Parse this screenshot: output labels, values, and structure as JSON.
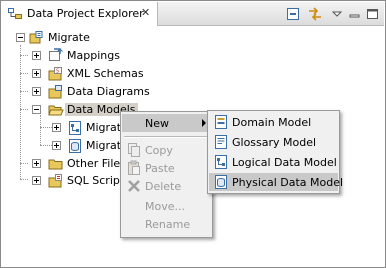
{
  "view": {
    "title": "Data Project Explorer",
    "close_glyph": "✕"
  },
  "toolbar": {
    "icons": [
      "collapse-all-icon",
      "link-with-editor-icon",
      "view-menu-icon",
      "minimize-icon",
      "maximize-icon"
    ]
  },
  "tree": {
    "root": {
      "label": "Migrate",
      "icon": "data-project-icon",
      "expanded": true
    },
    "items": [
      {
        "label": "Mappings",
        "icon": "mappings-icon"
      },
      {
        "label": "XML Schemas",
        "icon": "xml-schemas-icon"
      },
      {
        "label": "Data Diagrams",
        "icon": "data-diagrams-icon"
      },
      {
        "label": "Data Models",
        "icon": "folder-open-icon",
        "expanded": true,
        "selected": true,
        "children": [
          {
            "label": "Migrate",
            "icon": "logical-model-icon"
          },
          {
            "label": "Migrate",
            "icon": "physical-model-icon"
          }
        ]
      },
      {
        "label": "Other Files",
        "icon": "folder-icon"
      },
      {
        "label": "SQL Scripts",
        "icon": "sql-scripts-icon"
      }
    ]
  },
  "context_menu": {
    "items": [
      {
        "label": "New",
        "enabled": true,
        "submenu": true,
        "highlighted": true
      },
      {
        "label": "Copy",
        "enabled": false,
        "icon": "copy-icon"
      },
      {
        "label": "Paste",
        "enabled": false,
        "icon": "paste-icon"
      },
      {
        "label": "Delete",
        "enabled": false,
        "icon": "delete-icon"
      },
      {
        "label": "Move...",
        "enabled": false
      },
      {
        "label": "Rename",
        "enabled": false
      }
    ]
  },
  "submenu": {
    "items": [
      {
        "label": "Domain Model",
        "icon": "domain-model-icon"
      },
      {
        "label": "Glossary Model",
        "icon": "glossary-model-icon"
      },
      {
        "label": "Logical Data Model",
        "icon": "logical-data-model-icon"
      },
      {
        "label": "Physical Data Model",
        "icon": "physical-data-model-icon",
        "highlighted": true
      }
    ]
  },
  "colors": {
    "selection": "#d4d0c8",
    "menu_highlight": "#c9c9c9",
    "disabled_text": "#9a9a9a",
    "icon_blue": "#3a6ea5",
    "folder_yellow": "#e8c85a"
  }
}
